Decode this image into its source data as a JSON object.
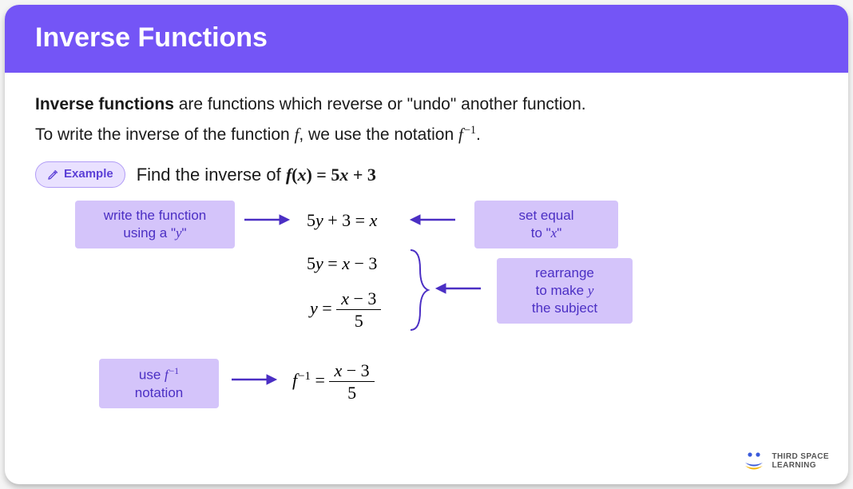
{
  "header": {
    "title": "Inverse Functions"
  },
  "intro": {
    "bold": "Inverse functions",
    "rest": " are functions which reverse or \"undo\" another function.",
    "line2_a": "To write the inverse of the function ",
    "line2_b": ", we use the notation ",
    "line2_c": "."
  },
  "example": {
    "badge": "Example",
    "prompt_a": "Find the inverse of ",
    "prompt_eq": "f(x) = 5x + 3"
  },
  "steps": {
    "step1_hint_a": "write the function",
    "step1_hint_b": "using a \"",
    "step1_hint_c": "\"",
    "eq1": "5y + 3 = x",
    "right1_a": "set equal",
    "right1_b": "to \"",
    "right1_c": "\"",
    "eq2": "5y = x − 3",
    "eq3_lhs": "y = ",
    "eq3_num": "x − 3",
    "eq3_den": "5",
    "right2_a": "rearrange",
    "right2_b": "to make ",
    "right2_c": "the subject",
    "step3_a": "use ",
    "step3_b": "notation",
    "eq4_lhs_a": "f",
    "eq4_lhs_b": " = ",
    "eq4_num": "x − 3",
    "eq4_den": "5"
  },
  "logo": {
    "line1": "THIRD SPACE",
    "line2": "LEARNING"
  }
}
